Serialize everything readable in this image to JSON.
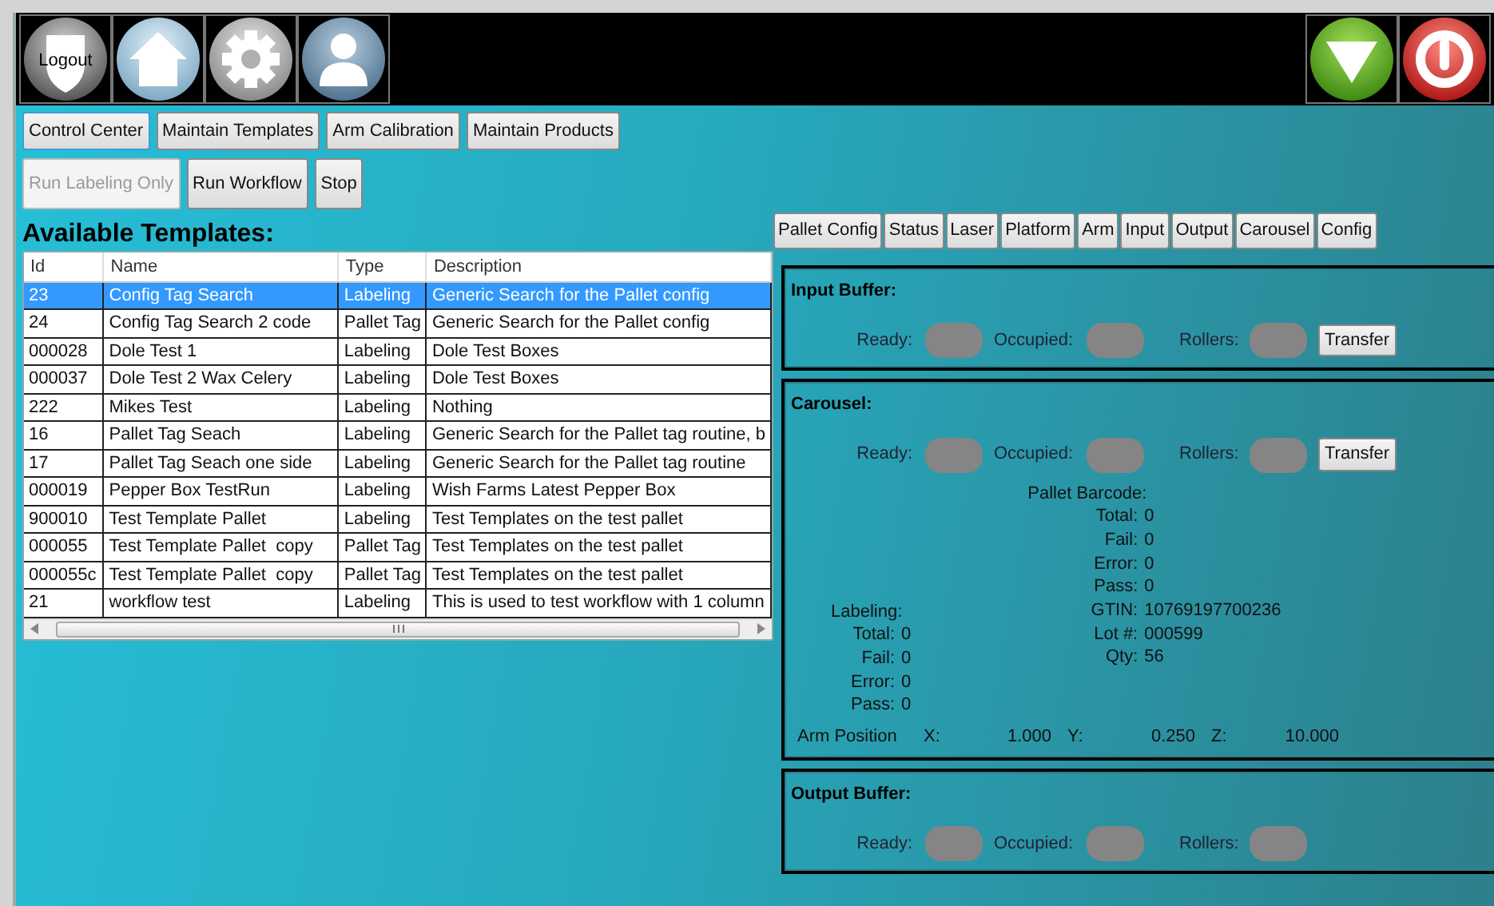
{
  "top_buttons": [
    {
      "kind": "logout",
      "label": "Logout"
    },
    {
      "kind": "home"
    },
    {
      "kind": "settings"
    },
    {
      "kind": "user"
    }
  ],
  "top_right_buttons": [
    {
      "kind": "down"
    },
    {
      "kind": "power"
    }
  ],
  "nav_buttons": [
    {
      "label": "Control Center",
      "selected": true
    },
    {
      "label": "Maintain Templates",
      "selected": false
    },
    {
      "label": "Arm Calibration",
      "selected": false
    },
    {
      "label": "Maintain Products",
      "selected": false
    }
  ],
  "action_buttons": [
    {
      "label": "Run Labeling Only",
      "disabled": true
    },
    {
      "label": "Run Workflow",
      "disabled": false
    },
    {
      "label": "Stop",
      "disabled": false
    }
  ],
  "templates": {
    "title": "Available Templates:",
    "columns": [
      "Id",
      "Name",
      "Type",
      "Description"
    ],
    "rows": [
      {
        "cells": [
          "23",
          "Config Tag Search",
          "Labeling",
          "Generic Search for the Pallet config"
        ],
        "selected": true
      },
      {
        "cells": [
          "24",
          "Config Tag Search 2 code",
          "Pallet Tag",
          "Generic Search for the Pallet config"
        ],
        "selected": false
      },
      {
        "cells": [
          "000028",
          "Dole Test 1",
          "Labeling",
          "Dole Test Boxes"
        ],
        "selected": false
      },
      {
        "cells": [
          "000037",
          "Dole Test 2 Wax Celery",
          "Labeling",
          "Dole Test Boxes"
        ],
        "selected": false
      },
      {
        "cells": [
          "222",
          "Mikes Test",
          "Labeling",
          "Nothing"
        ],
        "selected": false
      },
      {
        "cells": [
          "16",
          "Pallet Tag Seach",
          "Labeling",
          "Generic Search for the Pallet tag routine, b"
        ],
        "selected": false
      },
      {
        "cells": [
          "17",
          "Pallet Tag Seach one side",
          "Labeling",
          "Generic Search for the Pallet tag routine"
        ],
        "selected": false
      },
      {
        "cells": [
          "000019",
          "Pepper Box TestRun",
          "Labeling",
          "Wish Farms Latest Pepper Box"
        ],
        "selected": false
      },
      {
        "cells": [
          "900010",
          "Test Template Pallet",
          "Labeling",
          "Test Templates on the test pallet"
        ],
        "selected": false
      },
      {
        "cells": [
          "000055",
          "Test Template Pallet  copy",
          "Pallet Tag",
          "Test Templates on the test pallet"
        ],
        "selected": false
      },
      {
        "cells": [
          "000055c",
          "Test Template Pallet  copy",
          "Pallet Tag",
          "Test Templates on the test pallet"
        ],
        "selected": false
      },
      {
        "cells": [
          "21",
          "workflow test",
          "Labeling",
          "This is used to test workflow with 1 column"
        ],
        "selected": false
      }
    ]
  },
  "tabs": [
    "Pallet Config",
    "Status",
    "Laser",
    "Platform",
    "Arm",
    "Input",
    "Output",
    "Carousel",
    "Config"
  ],
  "input_buffer": {
    "title": "Input Buffer:",
    "indicators": [
      "Ready:",
      "Occupied:",
      "Rollers:"
    ],
    "button": "Transfer"
  },
  "carousel": {
    "title": "Carousel:",
    "indicators": [
      "Ready:",
      "Occupied:",
      "Rollers:"
    ],
    "button": "Transfer",
    "labeling": {
      "title": "Labeling:",
      "stats": [
        {
          "label": "Total:",
          "value": "0"
        },
        {
          "label": "Fail:",
          "value": "0"
        },
        {
          "label": "Error:",
          "value": "0"
        },
        {
          "label": "Pass:",
          "value": "0"
        }
      ]
    },
    "pallet_barcode": {
      "title": "Pallet Barcode:",
      "stats": [
        {
          "label": "Total:",
          "value": "0"
        },
        {
          "label": "Fail:",
          "value": "0"
        },
        {
          "label": "Error:",
          "value": "0"
        },
        {
          "label": "Pass:",
          "value": "0"
        },
        {
          "label": "GTIN:",
          "value": "10769197700236"
        },
        {
          "label": "Lot #:",
          "value": "000599"
        },
        {
          "label": "Qty:",
          "value": "56"
        }
      ]
    },
    "arm_position": {
      "label": "Arm Position",
      "axes": [
        {
          "label": "X:",
          "value": "1.000"
        },
        {
          "label": "Y:",
          "value": "0.250"
        },
        {
          "label": "Z:",
          "value": "10.000"
        }
      ]
    }
  },
  "output_buffer": {
    "title": "Output Buffer:",
    "indicators": [
      "Ready:",
      "Occupied:",
      "Rollers:"
    ]
  }
}
